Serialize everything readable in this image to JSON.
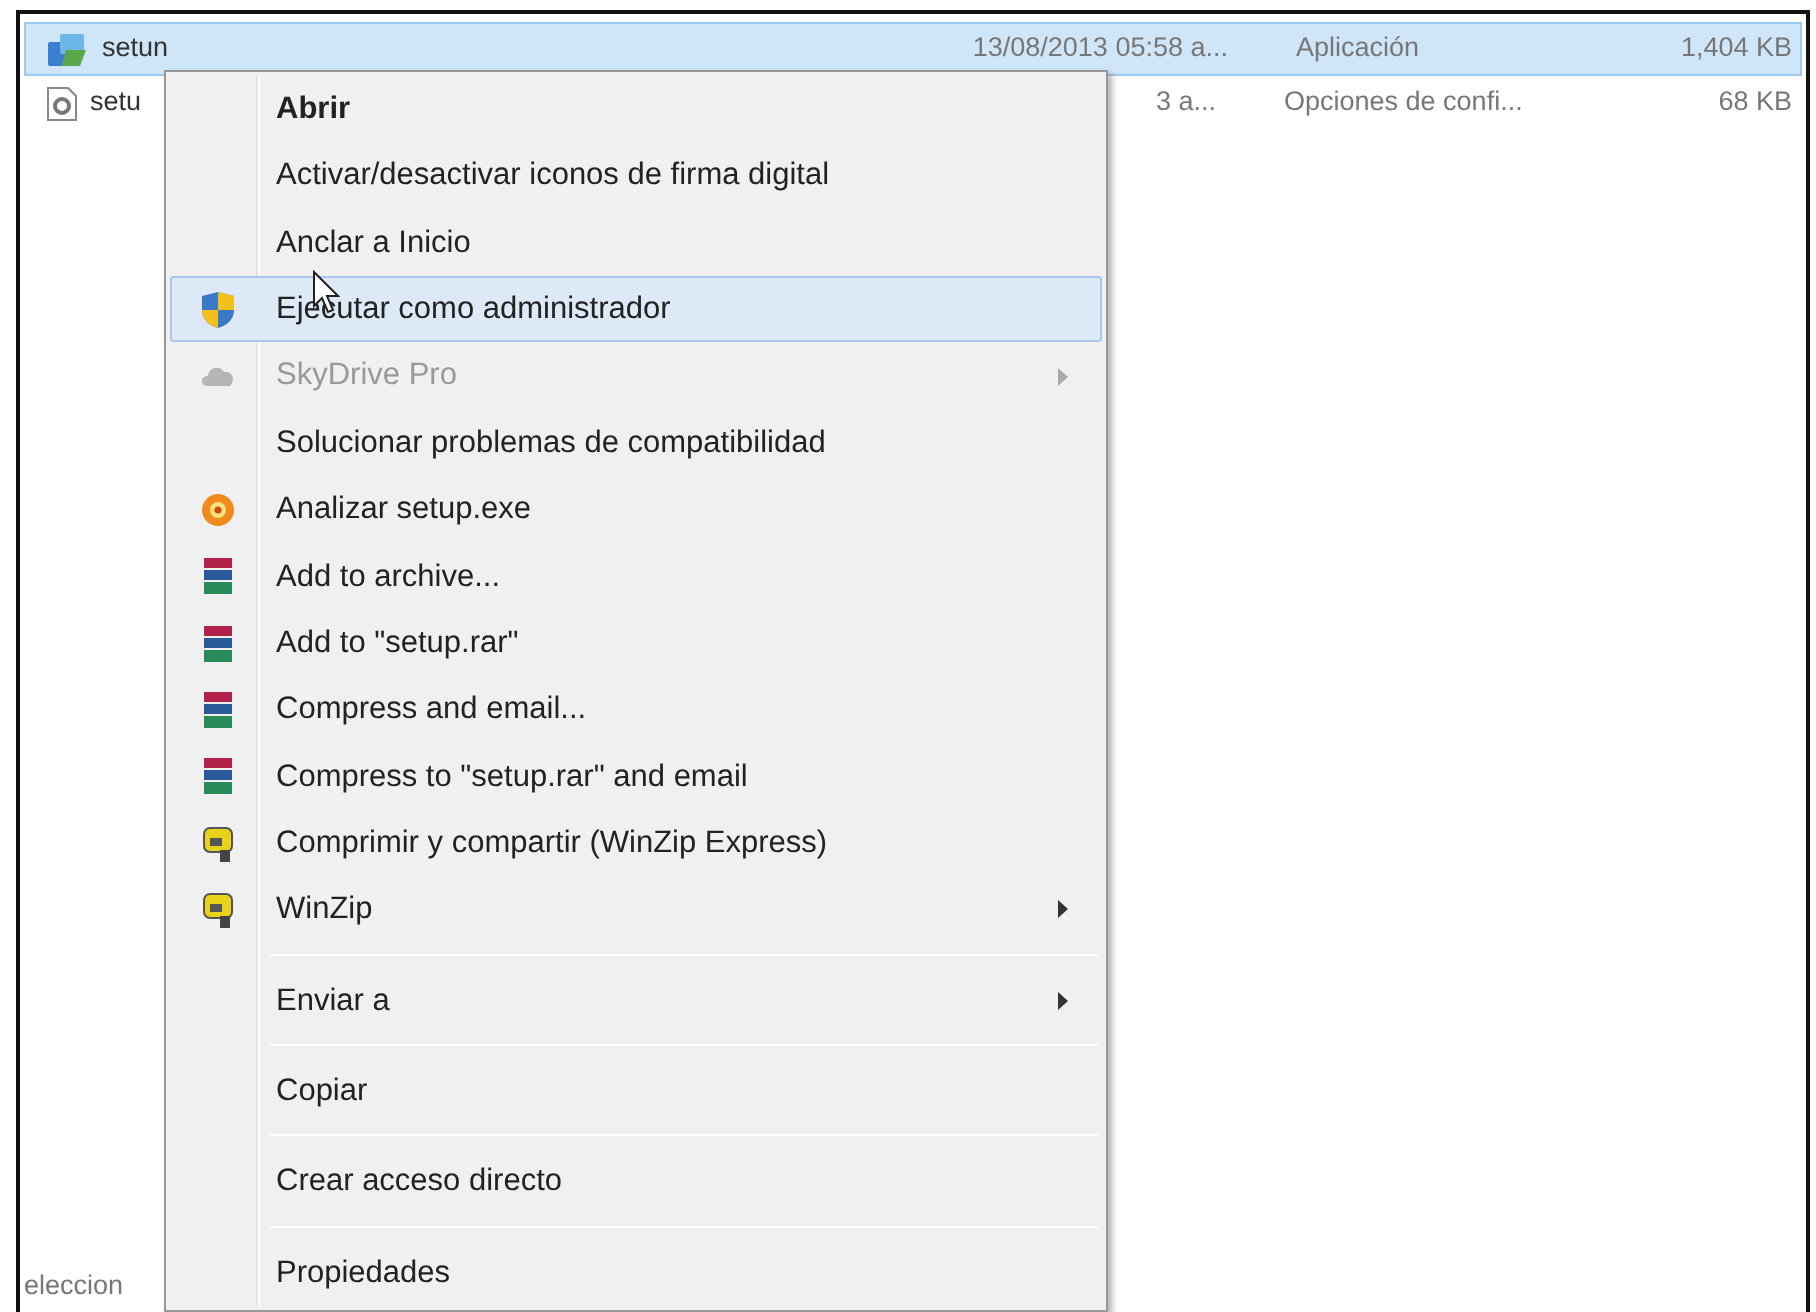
{
  "files": [
    {
      "kind": "installer",
      "name": "setun",
      "date": "13/08/2013 05:58 a...",
      "type": "Aplicación",
      "size": "1,404 KB",
      "selected": true
    },
    {
      "kind": "settings",
      "name": "setu",
      "date": "3 a...",
      "type": "Opciones de confi...",
      "size": "68 KB",
      "selected": false
    }
  ],
  "status_bar": "eleccion",
  "context_menu": [
    {
      "kind": "plain",
      "label": "Abrir",
      "default": true,
      "selected": false,
      "disabled": false,
      "submenu": false
    },
    {
      "kind": "plain",
      "label": "Activar/desactivar iconos de firma digital",
      "default": false,
      "selected": false,
      "disabled": false,
      "submenu": false
    },
    {
      "kind": "plain",
      "label": "Anclar a Inicio",
      "default": false,
      "selected": false,
      "disabled": false,
      "submenu": false
    },
    {
      "kind": "shield",
      "label": "Ejecutar como administrador",
      "default": false,
      "selected": true,
      "disabled": false,
      "submenu": false
    },
    {
      "kind": "cloud",
      "label": "SkyDrive Pro",
      "default": false,
      "selected": false,
      "disabled": true,
      "submenu": true
    },
    {
      "kind": "plain",
      "label": "Solucionar problemas de compatibilidad",
      "default": false,
      "selected": false,
      "disabled": false,
      "submenu": false
    },
    {
      "kind": "orb",
      "label": "Analizar setup.exe",
      "default": false,
      "selected": false,
      "disabled": false,
      "submenu": false
    },
    {
      "kind": "books",
      "label": "Add to archive...",
      "default": false,
      "selected": false,
      "disabled": false,
      "submenu": false
    },
    {
      "kind": "books",
      "label": "Add to \"setup.rar\"",
      "default": false,
      "selected": false,
      "disabled": false,
      "submenu": false
    },
    {
      "kind": "books",
      "label": "Compress and email...",
      "default": false,
      "selected": false,
      "disabled": false,
      "submenu": false
    },
    {
      "kind": "books",
      "label": "Compress to \"setup.rar\" and email",
      "default": false,
      "selected": false,
      "disabled": false,
      "submenu": false
    },
    {
      "kind": "clamp",
      "label": "Comprimir y compartir (WinZip Express)",
      "default": false,
      "selected": false,
      "disabled": false,
      "submenu": false
    },
    {
      "kind": "clamp",
      "label": "WinZip",
      "default": false,
      "selected": false,
      "disabled": false,
      "submenu": true
    },
    {
      "kind": "separator"
    },
    {
      "kind": "plain",
      "label": "Enviar a",
      "default": false,
      "selected": false,
      "disabled": false,
      "submenu": true
    },
    {
      "kind": "separator"
    },
    {
      "kind": "plain",
      "label": "Copiar",
      "default": false,
      "selected": false,
      "disabled": false,
      "submenu": false
    },
    {
      "kind": "separator"
    },
    {
      "kind": "plain",
      "label": "Crear acceso directo",
      "default": false,
      "selected": false,
      "disabled": false,
      "submenu": false
    },
    {
      "kind": "separator"
    },
    {
      "kind": "plain",
      "label": "Propiedades",
      "default": false,
      "selected": false,
      "disabled": false,
      "submenu": false
    }
  ]
}
